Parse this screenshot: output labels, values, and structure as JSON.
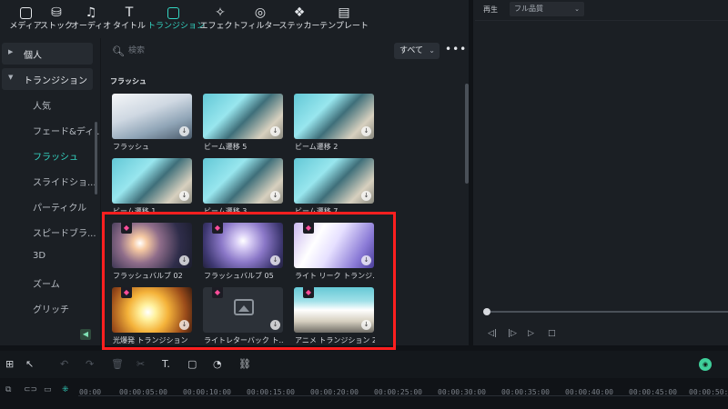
{
  "toolbar": {
    "items": [
      {
        "label": "メディア",
        "icon": "media-icon"
      },
      {
        "label": "ストック",
        "icon": "stock-icon"
      },
      {
        "label": "オーディオ",
        "icon": "audio-icon"
      },
      {
        "label": "タイトル",
        "icon": "title-icon"
      },
      {
        "label": "トランジション",
        "icon": "transition-icon",
        "active": true
      },
      {
        "label": "エフェクト",
        "icon": "effect-icon"
      },
      {
        "label": "フィルター",
        "icon": "filter-icon"
      },
      {
        "label": "ステッカー",
        "icon": "sticker-icon"
      },
      {
        "label": "テンプレート",
        "icon": "template-icon"
      }
    ]
  },
  "sidebar": {
    "groups": [
      {
        "label": "個人",
        "expanded": false
      },
      {
        "label": "トランジション",
        "expanded": true
      }
    ],
    "items": [
      {
        "label": "人気"
      },
      {
        "label": "フェード&ディ..."
      },
      {
        "label": "フラッシュ",
        "active": true
      },
      {
        "label": "スライドショ..."
      },
      {
        "label": "パーティクル"
      },
      {
        "label": "スピードブラ..."
      },
      {
        "label": "3D"
      },
      {
        "label": "ズーム"
      },
      {
        "label": "グリッチ"
      }
    ]
  },
  "content": {
    "search_placeholder": "検索",
    "filter": "すべて",
    "more": "•••",
    "section_title": "フラッシュ",
    "cards": [
      {
        "name": "フラッシュ",
        "premium": false
      },
      {
        "name": "ビーム遷移 5",
        "premium": false
      },
      {
        "name": "ビーム遷移 2",
        "premium": false
      },
      {
        "name": "ビーム遷移 1",
        "premium": false
      },
      {
        "name": "ビーム遷移 3",
        "premium": false
      },
      {
        "name": "ビーム遷移 7",
        "premium": false
      },
      {
        "name": "フラッシュバルブ 02",
        "premium": true
      },
      {
        "name": "フラッシュバルブ 05",
        "premium": true
      },
      {
        "name": "ライト リーク トランジ...",
        "premium": true
      },
      {
        "name": "光爆発 トランジション",
        "premium": true
      },
      {
        "name": "ライトレターバック ト...",
        "premium": true
      },
      {
        "name": "アニメ トランジション 2",
        "premium": true
      }
    ]
  },
  "player": {
    "label": "再生",
    "quality": "フル品質"
  },
  "timeline": {
    "ticks": [
      "00:00",
      "00:00:05:00",
      "00:00:10:00",
      "00:00:15:00",
      "00:00:20:00",
      "00:00:25:00",
      "00:00:30:00",
      "00:00:35:00",
      "00:00:40:00",
      "00:00:45:00",
      "00:00:50:0"
    ]
  },
  "colors": {
    "accent": "#34d6c3",
    "highlight_box": "#ff1f1f",
    "premium_gem": "#ff4d9a"
  }
}
